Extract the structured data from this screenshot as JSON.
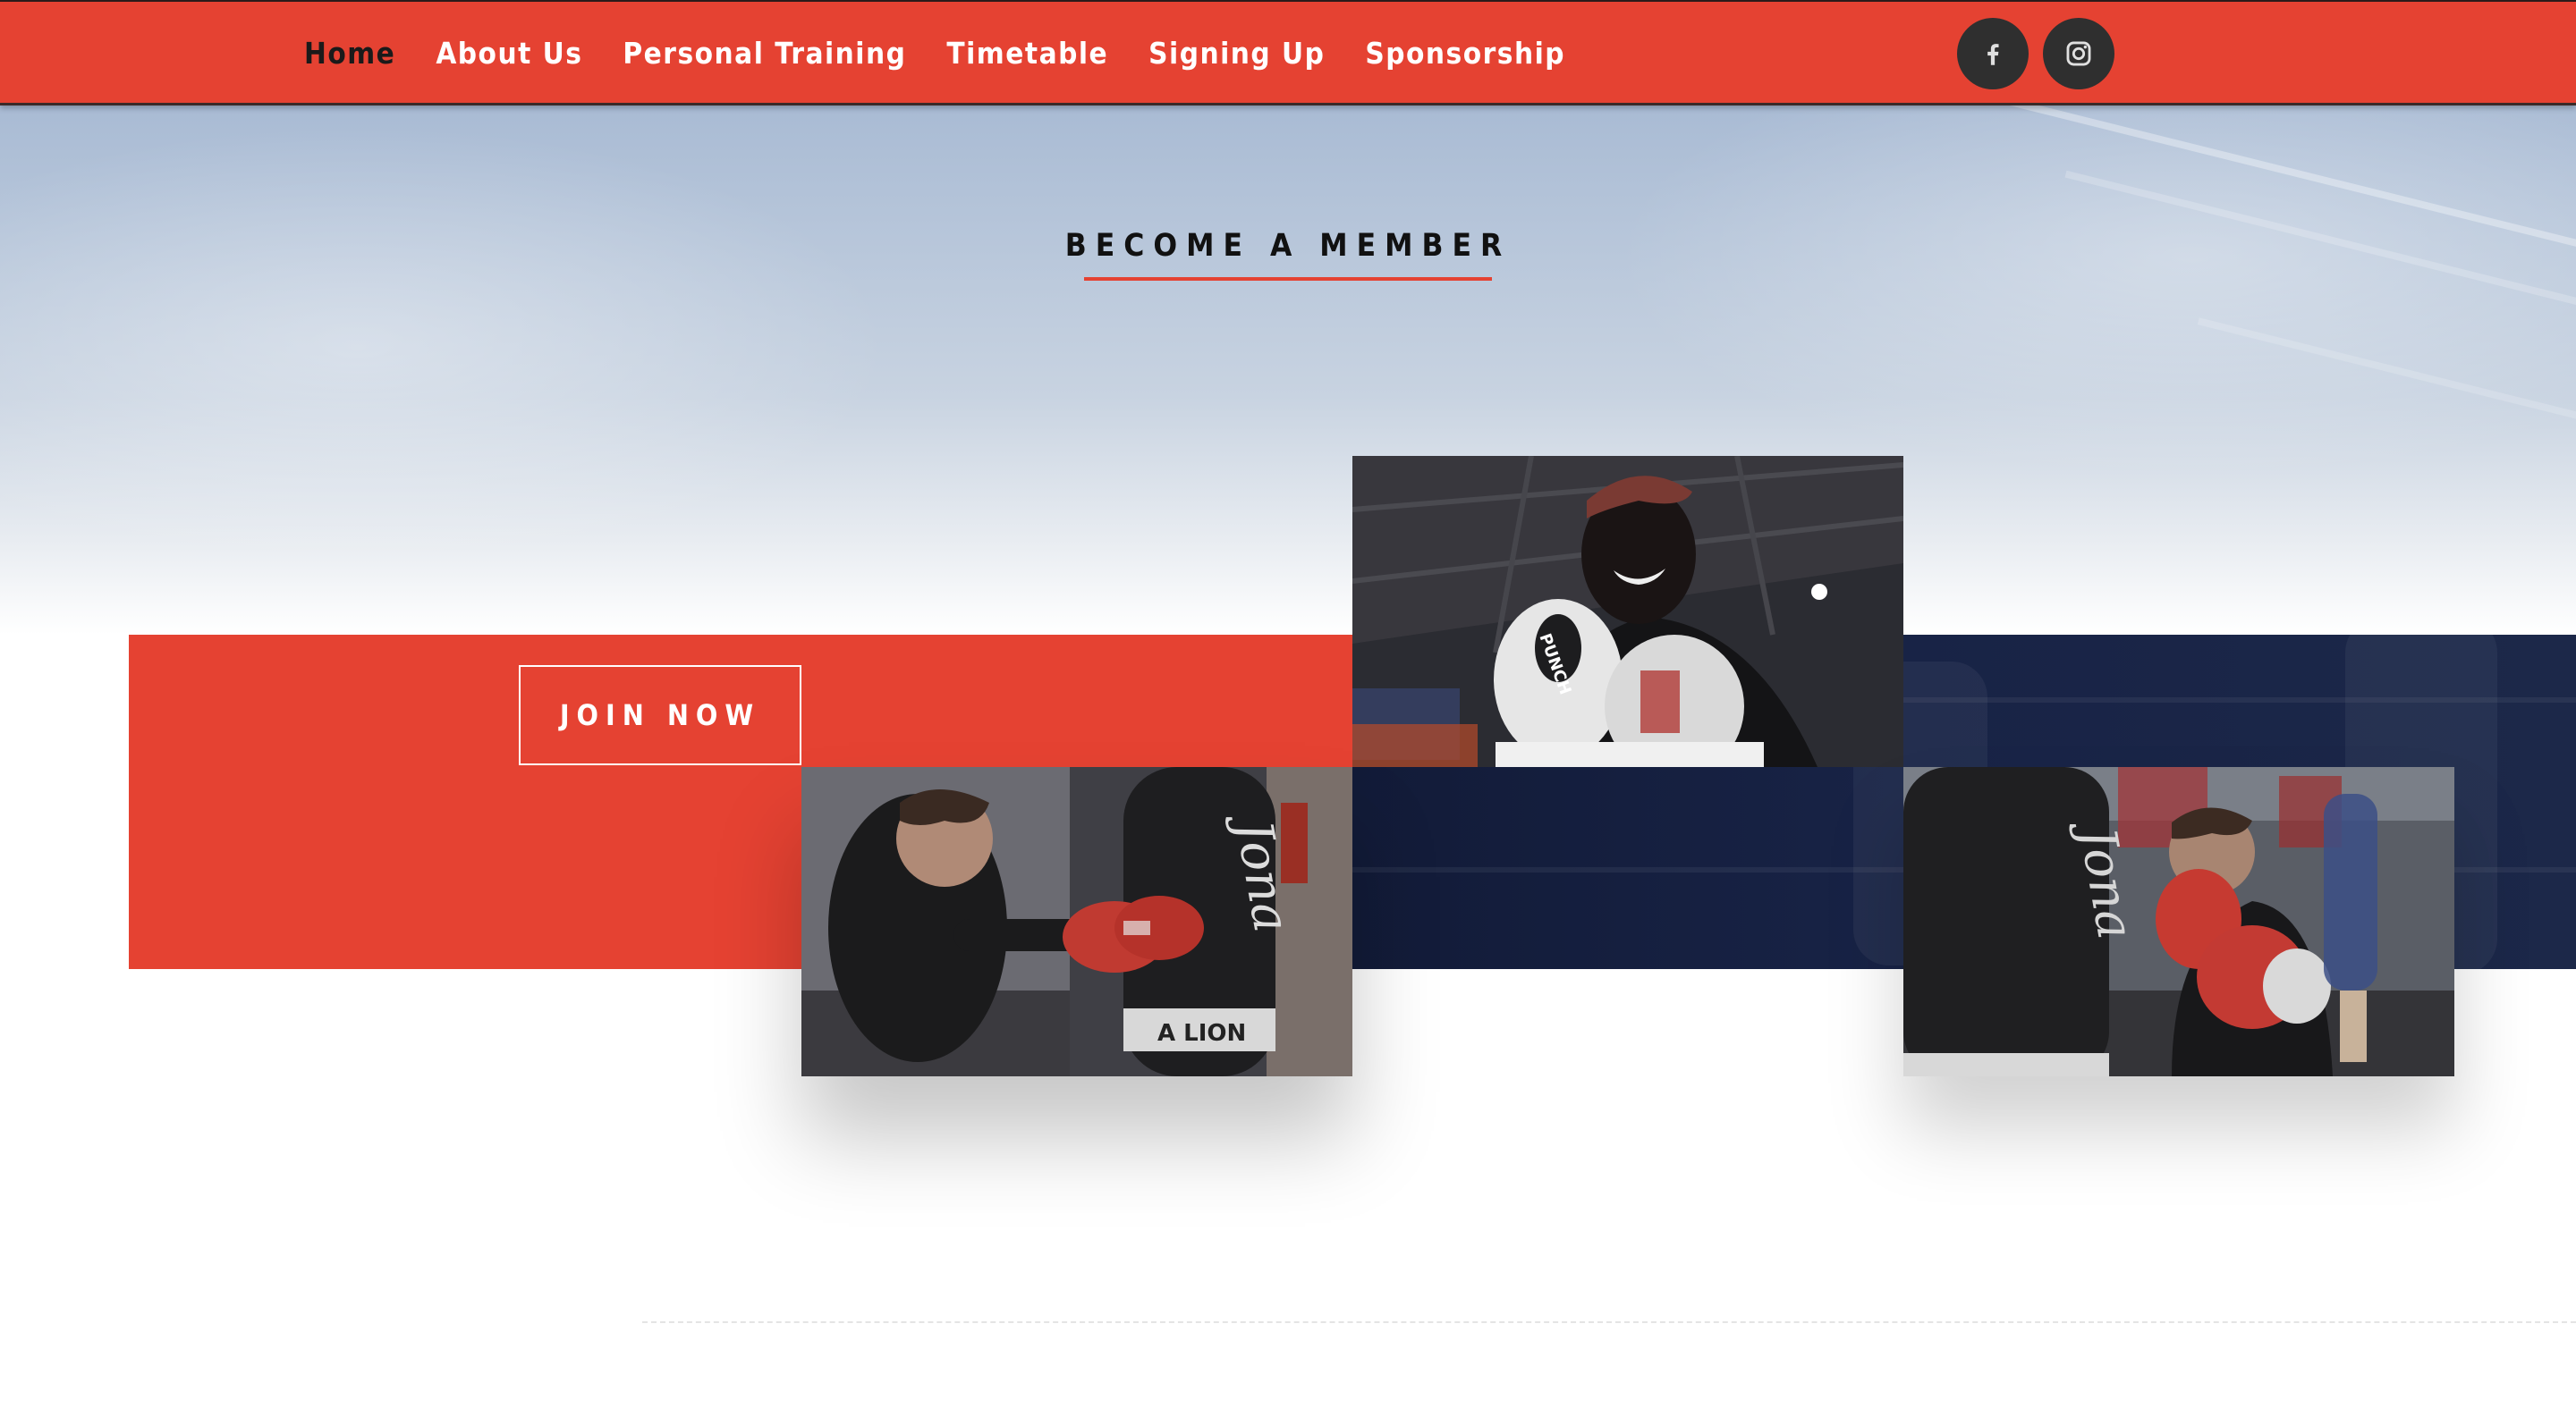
{
  "nav": {
    "items": [
      {
        "label": "Home",
        "active": true
      },
      {
        "label": "About Us",
        "active": false
      },
      {
        "label": "Personal Training",
        "active": false
      },
      {
        "label": "Timetable",
        "active": false
      },
      {
        "label": "Signing Up",
        "active": false
      },
      {
        "label": "Sponsorship",
        "active": false
      }
    ],
    "social": [
      {
        "icon": "facebook-icon"
      },
      {
        "icon": "instagram-icon"
      }
    ]
  },
  "hero": {
    "title": "BECOME A MEMBER"
  },
  "cta": {
    "join_label": "JOIN NOW"
  },
  "photos": {
    "p1": {
      "bag_text": "A LION",
      "brand_script": "Jona"
    },
    "p2": {
      "glove_text": "PUNCH"
    },
    "p3": {
      "brand_script": "Jona"
    }
  },
  "colors": {
    "brand_red": "#e54232",
    "navy": "#182346",
    "icon_bg": "#2f2f2f"
  }
}
